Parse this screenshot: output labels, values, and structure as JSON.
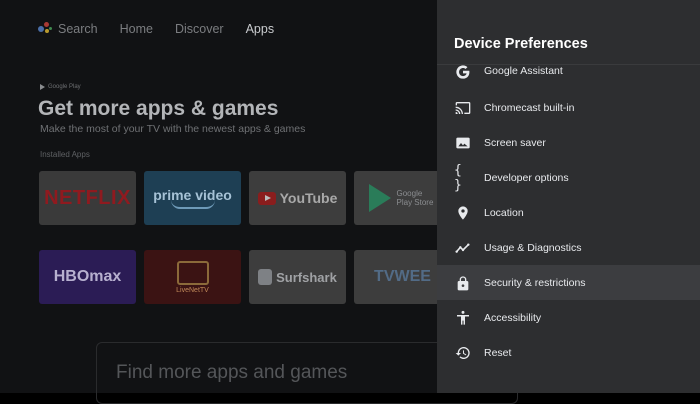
{
  "background": {
    "nav": {
      "search_label": "Search",
      "tabs": [
        "Home",
        "Discover",
        "Apps"
      ]
    },
    "google_play_tag": "Google Play",
    "hero_title": "Get more apps & games",
    "hero_subtitle": "Make the most of your TV with the newest apps & games",
    "installed_label": "Installed Apps",
    "apps_row1": [
      "NETFLIX",
      "prime video",
      "YouTube",
      "Google Play Store"
    ],
    "apps_row2": [
      "HBOmax",
      "LiveNetTV",
      "Surfshark",
      "TVWEE"
    ],
    "find_more": "Find more apps and games"
  },
  "panel": {
    "title": "Device Preferences",
    "items": [
      {
        "label": "Google Assistant",
        "icon": "google-g-icon"
      },
      {
        "label": "Chromecast built-in",
        "icon": "cast-icon"
      },
      {
        "label": "Screen saver",
        "icon": "screen-saver-icon"
      },
      {
        "label": "Developer options",
        "icon": "braces-icon"
      },
      {
        "label": "Location",
        "icon": "location-pin-icon"
      },
      {
        "label": "Usage & Diagnostics",
        "icon": "trending-line-icon"
      },
      {
        "label": "Security & restrictions",
        "icon": "lock-icon"
      },
      {
        "label": "Accessibility",
        "icon": "accessibility-icon"
      },
      {
        "label": "Reset",
        "icon": "reset-history-icon"
      }
    ],
    "focused_index": 6
  },
  "colors": {
    "panel_bg": "#2d2e30",
    "focus_bg": "#3c3d40",
    "text": "#e8eaed"
  }
}
